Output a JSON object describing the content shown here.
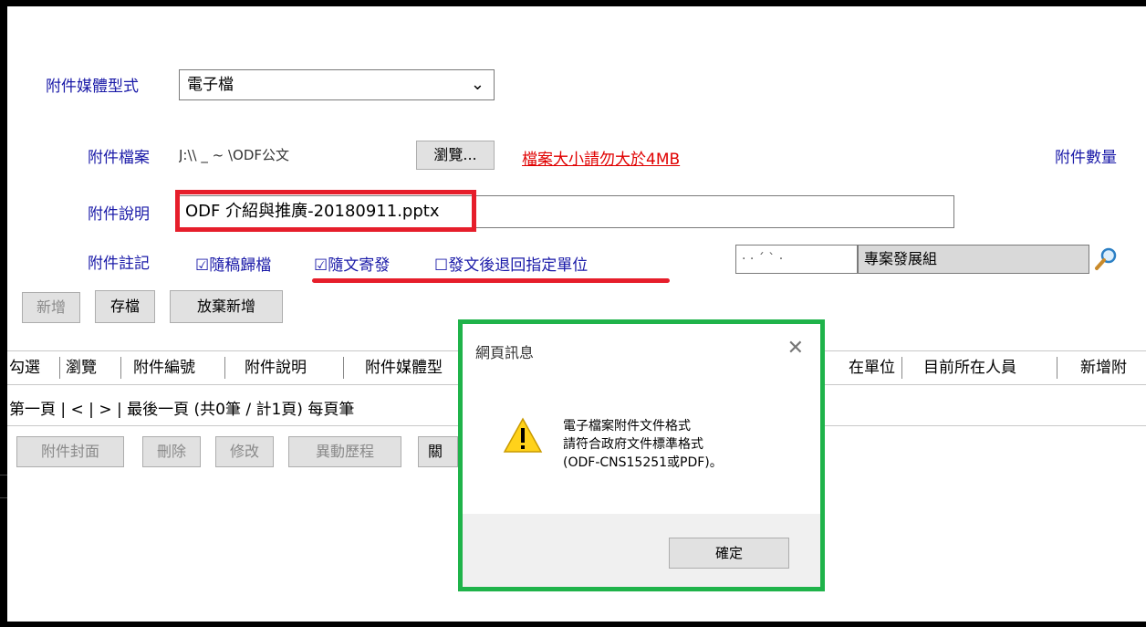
{
  "form": {
    "media_type_label": "附件媒體型式",
    "media_type_value": "電子檔",
    "file_label": "附件檔案",
    "file_value": "J:\\\\       _   ~   \\ODF公文",
    "browse_label": "瀏覽...",
    "size_warning": "檔案大小請勿大於4MB",
    "count_label": "附件數量",
    "desc_label": "附件說明",
    "desc_value": "ODF 介紹與推廣-20180911.pptx",
    "note_label": "附件註記",
    "check1": "☑隨稿歸檔",
    "check2": "☑隨文寄發",
    "check3": "☐發文後退回指定單位",
    "unit_code": "· · ´ ` ·",
    "unit_name": "專案發展組"
  },
  "actions": {
    "add": "新增",
    "save": "存檔",
    "cancel_add": "放棄新增"
  },
  "table": {
    "col_select": "勾選",
    "col_browse": "瀏覽",
    "col_no": "附件編號",
    "col_desc": "附件說明",
    "col_media": "附件媒體型",
    "col_unit": "在單位",
    "col_person": "目前所在人員",
    "col_new": "新增附"
  },
  "pager": {
    "text": "第一頁 | < | > | 最後一頁 (共0筆 / 計1頁) 每頁筆"
  },
  "bottom_buttons": {
    "cover": "附件封面",
    "delete": "刪除",
    "edit": "修改",
    "history": "異動歷程",
    "close": "關"
  },
  "dialog": {
    "title": "網頁訊息",
    "close": "✕",
    "line1": "電子檔案附件文件格式",
    "line2": "請符合政府文件標準格式",
    "line3": "(ODF-CNS15251或PDF)。",
    "ok": "確定"
  },
  "colors": {
    "highlight_red": "#e61e2b",
    "dialog_green": "#1fb34a",
    "label_blue": "#1a1aa8"
  }
}
